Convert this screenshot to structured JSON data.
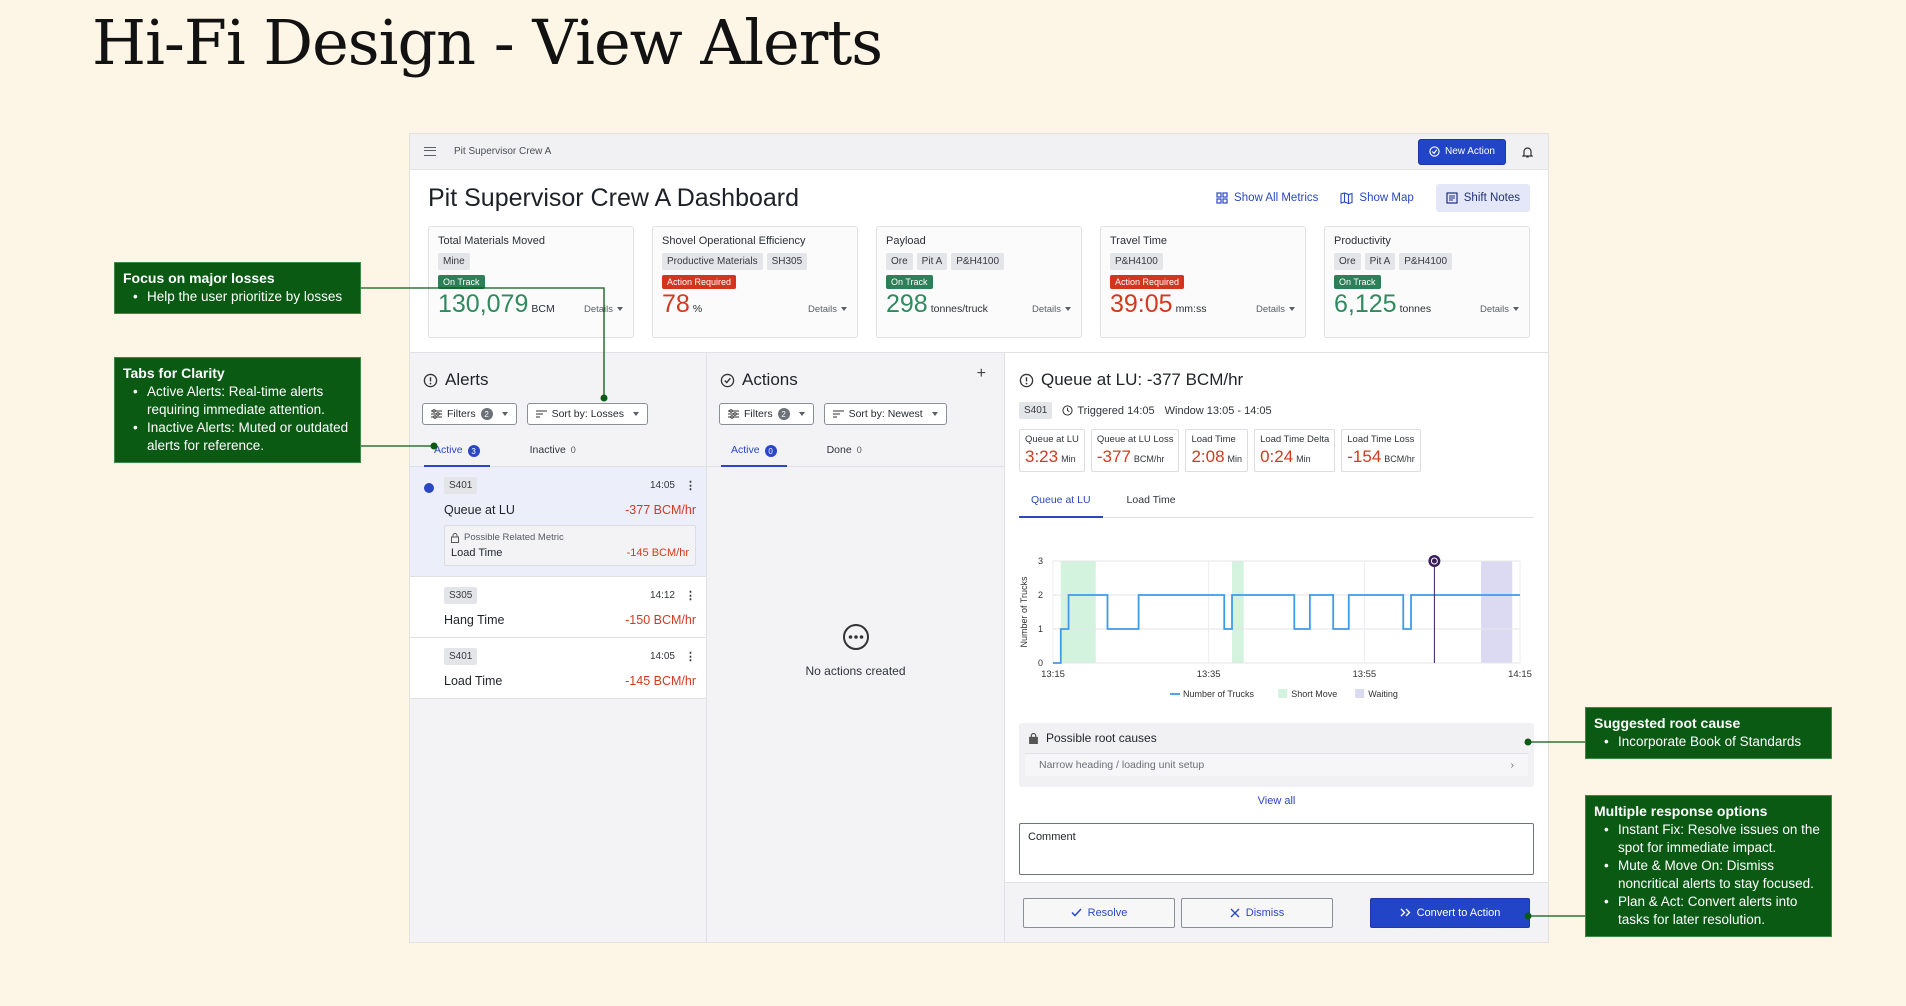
{
  "page_title": "Hi-Fi Design - View Alerts",
  "topbar": {
    "crumb": "Pit Supervisor Crew A",
    "new_action_label": "New Action"
  },
  "header": {
    "title": "Pit Supervisor Crew A Dashboard",
    "show_all_metrics": "Show All Metrics",
    "show_map": "Show Map",
    "shift_notes": "Shift Notes"
  },
  "metrics": [
    {
      "title": "Total Materials Moved",
      "chips": [
        "Mine"
      ],
      "status": "On Track",
      "value": "130,079",
      "unit": "BCM",
      "details": "Details"
    },
    {
      "title": "Shovel Operational Efficiency",
      "chips": [
        "Productive Materials",
        "SH305"
      ],
      "status": "Action Required",
      "value": "78",
      "unit": "%",
      "details": "Details"
    },
    {
      "title": "Payload",
      "chips": [
        "Ore",
        "Pit A",
        "P&H4100"
      ],
      "status": "On Track",
      "value": "298",
      "unit": "tonnes/truck",
      "details": "Details"
    },
    {
      "title": "Travel Time",
      "chips": [
        "P&H4100"
      ],
      "status": "Action Required",
      "value": "39:05",
      "unit": "mm:ss",
      "details": "Details"
    },
    {
      "title": "Productivity",
      "chips": [
        "Ore",
        "Pit A",
        "P&H4100"
      ],
      "status": "On Track",
      "value": "6,125",
      "unit": "tonnes",
      "details": "Details"
    }
  ],
  "alerts": {
    "title": "Alerts",
    "filters_label": "Filters",
    "filters_count": "2",
    "sort_label": "Sort by: Losses",
    "tab_active": "Active",
    "tab_active_count": "3",
    "tab_inactive": "Inactive",
    "tab_inactive_count": "0",
    "items": [
      {
        "unit": "S401",
        "time": "14:05",
        "name": "Queue at LU",
        "loss": "-377 BCM/hr",
        "related_label": "Possible Related Metric",
        "related_name": "Load Time",
        "related_loss": "-145 BCM/hr"
      },
      {
        "unit": "S305",
        "time": "14:12",
        "name": "Hang Time",
        "loss": "-150 BCM/hr"
      },
      {
        "unit": "S401",
        "time": "14:05",
        "name": "Load Time",
        "loss": "-145 BCM/hr"
      }
    ]
  },
  "actions": {
    "title": "Actions",
    "add_symbol": "+",
    "filters_label": "Filters",
    "filters_count": "2",
    "sort_label": "Sort by: Newest",
    "tab_active": "Active",
    "tab_active_count": "0",
    "tab_done": "Done",
    "tab_done_count": "0",
    "empty": "No actions created"
  },
  "detail": {
    "title": "Queue at LU: -377 BCM/hr",
    "unit": "S401",
    "triggered": "Triggered 14:05",
    "window": "Window 13:05 - 14:05",
    "stats": [
      {
        "label": "Queue at LU",
        "value": "3:23",
        "unit": "Min"
      },
      {
        "label": "Queue at LU Loss",
        "value": "-377",
        "unit": "BCM/hr"
      },
      {
        "label": "Load Time",
        "value": "2:08",
        "unit": "Min"
      },
      {
        "label": "Load Time Delta",
        "value": "0:24",
        "unit": "Min"
      },
      {
        "label": "Load Time Loss",
        "value": "-154",
        "unit": "BCM/hr"
      }
    ],
    "tab_1": "Queue at LU",
    "tab_2": "Load Time",
    "root_title": "Possible root causes",
    "root_item": "Narrow heading / loading unit setup",
    "view_all": "View all",
    "comment_label": "Comment",
    "resolve": "Resolve",
    "dismiss": "Dismiss",
    "convert": "Convert to Action"
  },
  "chart_data": {
    "type": "line",
    "ylabel": "Number of Trucks",
    "xlabel": "",
    "x_ticks": [
      "13:15",
      "13:35",
      "13:55",
      "14:15"
    ],
    "y_ticks": [
      0,
      1,
      2,
      3
    ],
    "ylim": [
      0,
      3
    ],
    "xlim_minutes": [
      0,
      60
    ],
    "series": [
      {
        "name": "Number of Trucks",
        "steps": [
          [
            0,
            0
          ],
          [
            1,
            1
          ],
          [
            2,
            2
          ],
          [
            7,
            1
          ],
          [
            11,
            2
          ],
          [
            22,
            1
          ],
          [
            23,
            2
          ],
          [
            31,
            1
          ],
          [
            33,
            2
          ],
          [
            36,
            1
          ],
          [
            38,
            2
          ],
          [
            40,
            2
          ],
          [
            45,
            1
          ],
          [
            46,
            2
          ],
          [
            48,
            2
          ]
        ]
      }
    ],
    "bands": [
      {
        "name": "Short Move",
        "from": 1,
        "to": 5.5,
        "color": "#d4f3df"
      },
      {
        "name": "Short Move",
        "from": 23,
        "to": 24.5,
        "color": "#d4f3df"
      },
      {
        "name": "Waiting",
        "from": 55,
        "to": 59,
        "color": "#dcd9f3"
      }
    ],
    "marker_minute": 49,
    "legend": [
      "Number of Trucks",
      "Short Move",
      "Waiting"
    ],
    "legend_position": "bottom"
  },
  "notes": {
    "losses": {
      "title": "Focus on major losses",
      "items": [
        "Help the user prioritize by losses"
      ]
    },
    "tabs": {
      "title": "Tabs for Clarity",
      "items": [
        "Active Alerts: Real-time alerts requiring immediate attention.",
        "Inactive Alerts: Muted or outdated alerts for reference."
      ]
    },
    "root": {
      "title": "Suggested root cause",
      "items": [
        "Incorporate Book of Standards"
      ]
    },
    "response": {
      "title": "Multiple response options",
      "items": [
        "Instant Fix: Resolve issues on the spot for immediate impact.",
        "Mute & Move On: Dismiss noncritical alerts to stay focused.",
        "Plan & Act: Convert alerts into tasks for later resolution."
      ]
    }
  }
}
